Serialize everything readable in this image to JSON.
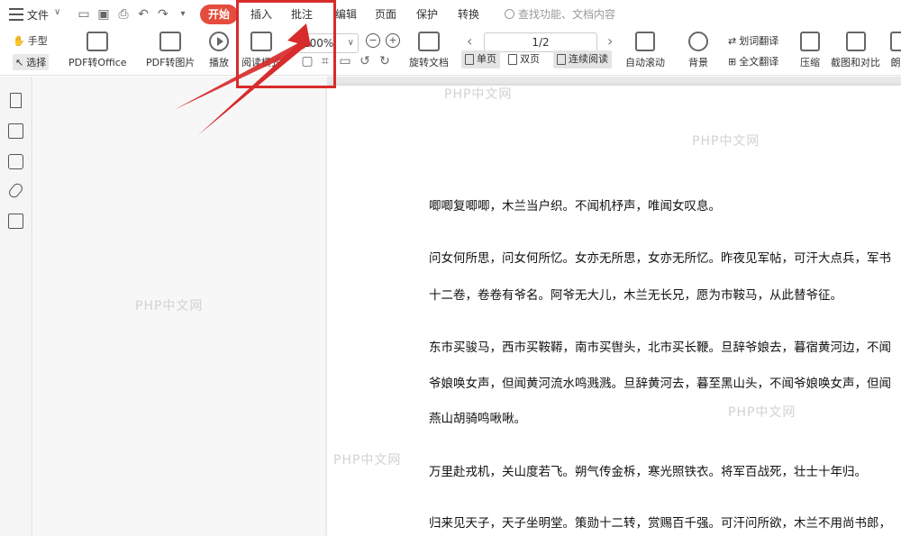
{
  "menubar": {
    "file_label": "文件",
    "tabs": [
      {
        "label": "开始"
      },
      {
        "label": "插入"
      },
      {
        "label": "批注"
      },
      {
        "label": "编辑"
      },
      {
        "label": "页面"
      },
      {
        "label": "保护"
      },
      {
        "label": "转换"
      }
    ],
    "search_placeholder": "查找功能、文档内容"
  },
  "toolbar": {
    "hand_label": "手型",
    "select_label": "选择",
    "pdf_office": "PDF转Office",
    "pdf_image": "PDF转图片",
    "play": "播放",
    "read_mode": "阅读模式",
    "zoom": "100%",
    "rotate_doc": "旋转文档",
    "page_indicator": "1/2",
    "single_page": "单页",
    "double_page": "双页",
    "continuous": "连续阅读",
    "auto_scroll": "自动滚动",
    "background": "背景",
    "word_translate": "划词翻译",
    "full_translate": "全文翻译",
    "compress": "压缩",
    "screenshot_compare": "截图和对比",
    "overflow": "朗"
  },
  "icons": {
    "rail": [
      "bookmark-icon",
      "image-icon",
      "comment-icon",
      "attachment-icon",
      "sign-icon"
    ]
  },
  "document": {
    "paragraphs": [
      "唧唧复唧唧，木兰当户织。不闻机杼声，唯闻女叹息。",
      "问女何所思，问女何所忆。女亦无所思，女亦无所忆。昨夜见军帖，可汗大点兵，军书",
      "十二卷，卷卷有爷名。阿爷无大儿，木兰无长兄，愿为市鞍马，从此替爷征。",
      "东市买骏马，西市买鞍鞯，南市买辔头，北市买长鞭。旦辞爷娘去，暮宿黄河边，不闻",
      "爷娘唤女声，但闻黄河流水鸣溅溅。旦辞黄河去，暮至黑山头，不闻爷娘唤女声，但闻",
      "燕山胡骑鸣啾啾。",
      "万里赴戎机，关山度若飞。朔气传金柝，寒光照铁衣。将军百战死，壮士十年归。",
      "归来见天子，天子坐明堂。策勋十二转，赏赐百千强。可汗问所欲，木兰不用尚书郎，"
    ]
  },
  "watermark": "PHP中文网",
  "colors": {
    "accent": "#e44c3d",
    "annotation": "#d82b2b"
  }
}
